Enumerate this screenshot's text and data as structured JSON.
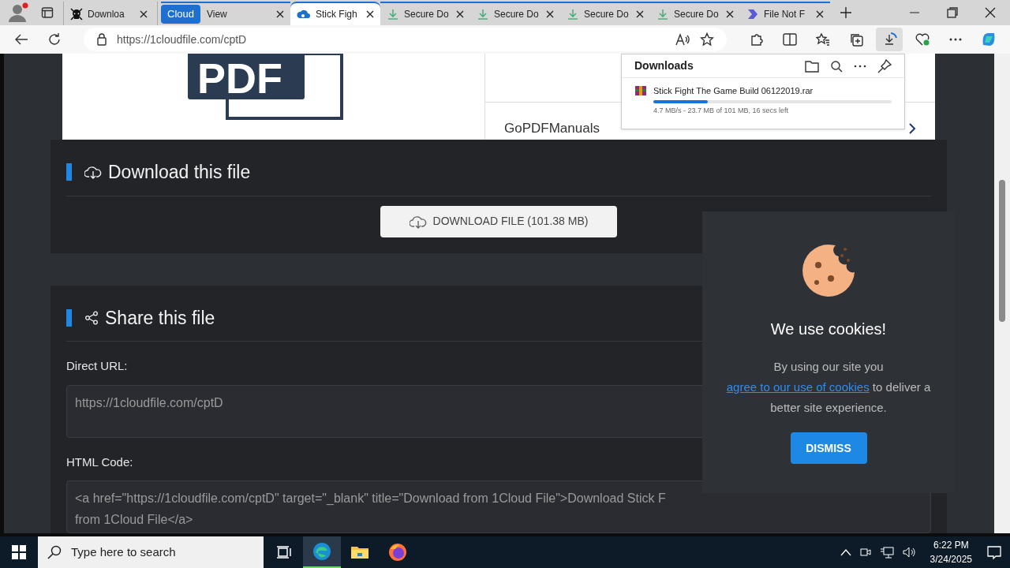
{
  "browser": {
    "tabs": [
      {
        "kind": "skull",
        "label": "Downloa",
        "selected": false
      }
    ],
    "tab_group": {
      "label": "Cloud",
      "tabs": [
        {
          "kind": "plain",
          "label": "View",
          "selected": false
        },
        {
          "kind": "cloud",
          "label": "Stick Figh",
          "selected": true
        },
        {
          "kind": "download",
          "label": "Secure Do",
          "selected": false
        },
        {
          "kind": "download",
          "label": "Secure Do",
          "selected": false
        },
        {
          "kind": "download",
          "label": "Secure Do",
          "selected": false
        },
        {
          "kind": "download",
          "label": "Secure Do",
          "selected": false
        },
        {
          "kind": "chevron",
          "label": "File Not F",
          "selected": false
        }
      ]
    },
    "url": "https://1cloudfile.com/cptD"
  },
  "downloads_panel": {
    "title": "Downloads",
    "items": [
      {
        "name": "Stick Fight The Game Build 06122019.rar",
        "level": 0.23,
        "status": "4.7 MB/s - 23.7 MB of 101 MB, 16 secs left"
      }
    ]
  },
  "ad": {
    "logo_text": "PDF",
    "brand": "GoPDFManuals"
  },
  "download_section": {
    "title": "Download this file",
    "button": "DOWNLOAD FILE (101.38 MB)"
  },
  "share_section": {
    "title": "Share this file",
    "fields": [
      {
        "label": "Direct URL:",
        "lines": [
          "https://1cloudfile.com/cptD"
        ]
      },
      {
        "label": "HTML Code:",
        "lines": [
          "<a href=\"https://1cloudfile.com/cptD\" target=\"_blank\" title=\"Download from 1Cloud File\">Download Stick F",
          "from 1Cloud File</a>"
        ]
      }
    ]
  },
  "cookie_popup": {
    "title": "We use cookies!",
    "text_before": "By using our site you",
    "link": "agree to our use of cookies",
    "text_after": "to deliver a better site experience.",
    "button": "DISMISS"
  },
  "taskbar": {
    "search_placeholder": "Type here to search",
    "apps": [
      {
        "kind": "taskview",
        "selected": false
      },
      {
        "kind": "edge",
        "selected": true
      },
      {
        "kind": "explorer",
        "selected": false
      },
      {
        "kind": "firefox",
        "selected": false
      }
    ],
    "time": "6:22 PM",
    "date": "3/24/2025"
  }
}
